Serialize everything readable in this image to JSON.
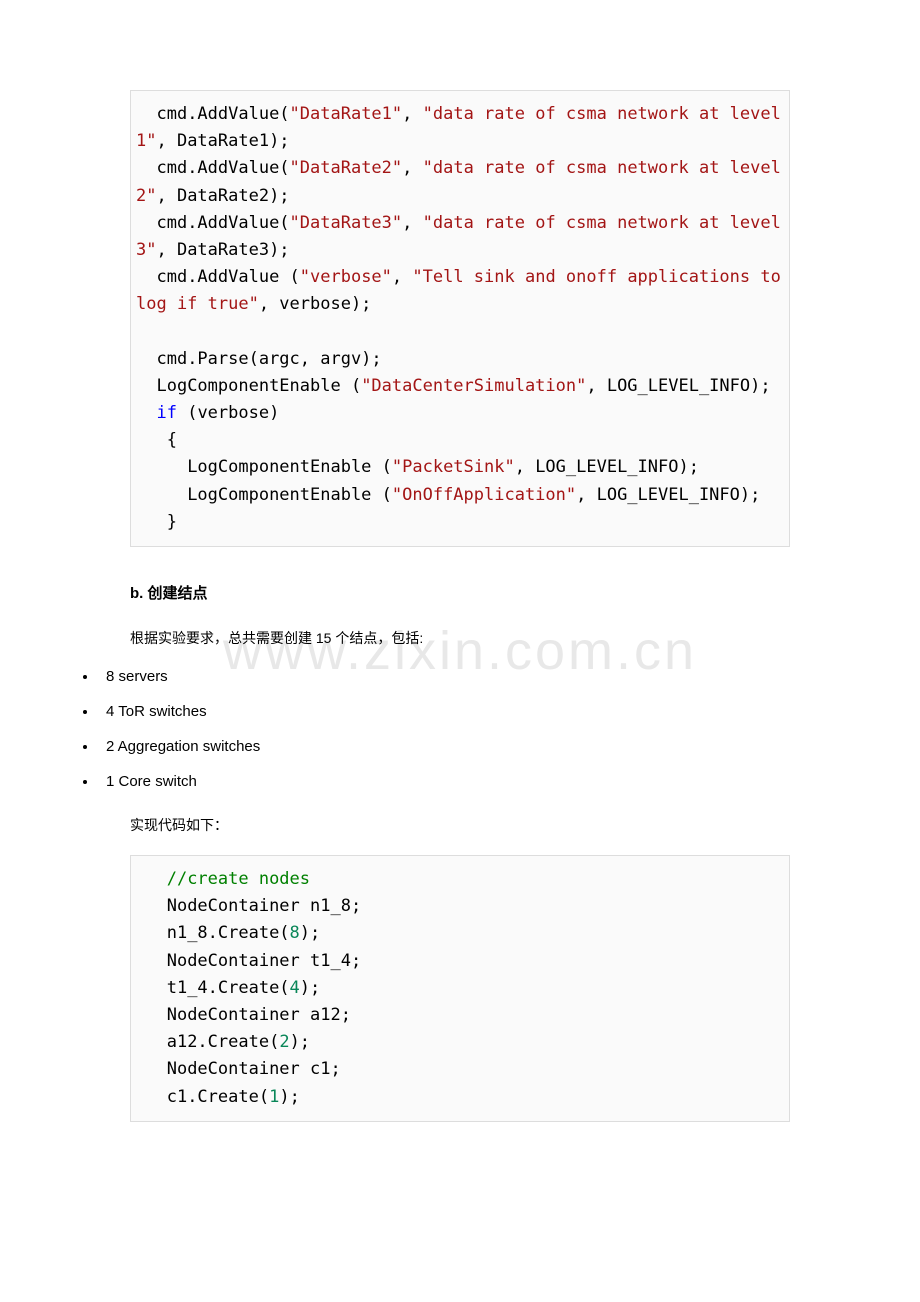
{
  "watermark": "www.zixin.com.cn",
  "code1": {
    "l1a": "  cmd.AddValue(",
    "l1b": "\"DataRate1\"",
    "l1c": ", ",
    "l1d": "\"data rate of csma network at level 1\"",
    "l1e": ", DataRate1);",
    "l2a": "  cmd.AddValue(",
    "l2b": "\"DataRate2\"",
    "l2c": ", ",
    "l2d": "\"data rate of csma network at level 2\"",
    "l2e": ", DataRate2);",
    "l3a": "  cmd.AddValue(",
    "l3b": "\"DataRate3\"",
    "l3c": ", ",
    "l3d": "\"data rate of csma network at level 3\"",
    "l3e": ", DataRate3);",
    "l4a": "  cmd.AddValue (",
    "l4b": "\"verbose\"",
    "l4c": ", ",
    "l4d": "\"Tell sink and onoff applications to log if true\"",
    "l4e": ", verbose);",
    "blank": "",
    "l5": "  cmd.Parse(argc, argv);",
    "l6a": "  LogComponentEnable (",
    "l6b": "\"DataCenterSimulation\"",
    "l6c": ", LOG_LEVEL_INFO);",
    "l7a": "  ",
    "l7b": "if",
    "l7c": " (verbose)",
    "l8": "   {",
    "l9a": "     LogComponentEnable (",
    "l9b": "\"PacketSink\"",
    "l9c": ", LOG_LEVEL_INFO);",
    "l10a": "     LogComponentEnable (",
    "l10b": "\"OnOffApplication\"",
    "l10c": ", LOG_LEVEL_INFO);",
    "l11": "   }"
  },
  "heading_b": "b. 创建结点",
  "para_nodes": "根据实验要求，总共需要创建 15 个结点，包括:",
  "bullets": {
    "b1": "8 servers",
    "b2": "4 ToR switches",
    "b3": "2 Aggregation switches",
    "b4": "1 Core switch"
  },
  "para_code": "实现代码如下：",
  "code2": {
    "l1": "   //create nodes",
    "l2": "   NodeContainer n1_8;",
    "l3a": "   n1_8.Create(",
    "l3b": "8",
    "l3c": ");",
    "l4": "   NodeContainer t1_4;",
    "l5a": "   t1_4.Create(",
    "l5b": "4",
    "l5c": ");",
    "l6": "   NodeContainer a12;",
    "l7a": "   a12.Create(",
    "l7b": "2",
    "l7c": ");",
    "l8": "   NodeContainer c1;",
    "l9a": "   c1.Create(",
    "l9b": "1",
    "l9c": ");"
  }
}
